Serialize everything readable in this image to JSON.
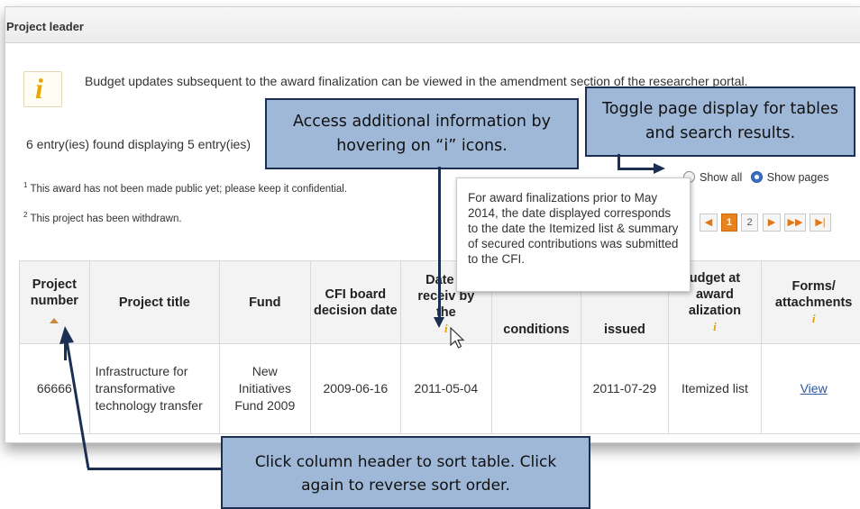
{
  "panel": {
    "title": "Project leader"
  },
  "notice": "Budget updates subsequent to the award finalization can be viewed in the amendment section of the researcher portal.",
  "entries": "6 entry(ies) found displaying 5 entry(ies)",
  "notes": [
    {
      "sup": "1",
      "text": " This award has not been made public yet; please keep it confidential."
    },
    {
      "sup": "2",
      "text": " This project has been withdrawn."
    }
  ],
  "display": {
    "show_all": "Show all",
    "show_pages": "Show pages",
    "selected": "show_pages"
  },
  "pager": {
    "page1": "1",
    "page2": "2"
  },
  "tooltip": "For award finalizations prior to May 2014, the date displayed corresponds to the date the Itemized list & summary of secured contributions was submitted to the CFI.",
  "table": {
    "headers": {
      "project_number": "Project number",
      "project_title": "Project title",
      "fund": "Fund",
      "cfi_board": "CFI board decision date",
      "date_received": "Date A receiv by the",
      "conditions": "conditions",
      "issued": "issued",
      "budget": "udget at award alization",
      "forms": "Forms/ attachments"
    },
    "row": {
      "project_number": "66666",
      "project_title": "Infrastructure for transformative technology transfer",
      "fund": "New Initiatives Fund 2009",
      "cfi_board": "2009-06-16",
      "date_received": "2011-05-04",
      "conditions": "",
      "issued": "2011-07-29",
      "budget": "Itemized list",
      "forms": "View"
    }
  },
  "callouts": {
    "info": "Access additional information by hovering on “i” icons.",
    "toggle": "Toggle page display for tables and search results.",
    "sort": "Click column header to sort table. Click again to reverse sort order."
  },
  "colors": {
    "callout_bg": "#9fb8d8",
    "callout_border": "#1b2f52",
    "info_icon": "#e8a800",
    "pager_current": "#e7821d",
    "link": "#2b57a6"
  }
}
